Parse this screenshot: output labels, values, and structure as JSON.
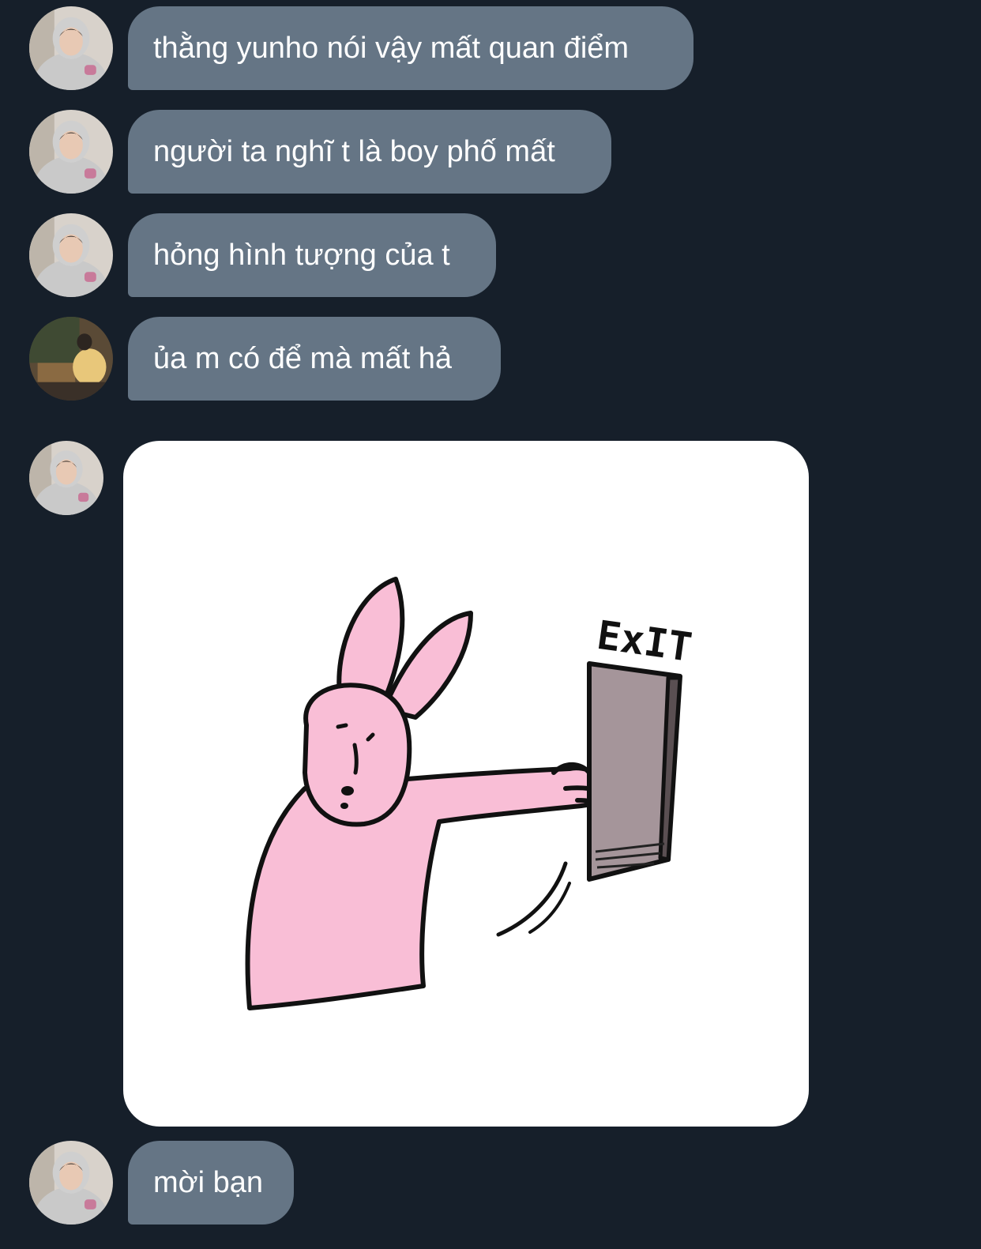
{
  "messages": [
    {
      "text": "thằng yunho nói vậy mất quan điểm",
      "avatar": "user-a"
    },
    {
      "text": "người ta nghĩ t là boy phố mất",
      "avatar": "user-a"
    },
    {
      "text": "hỏng hình tượng của t",
      "avatar": "user-a"
    },
    {
      "text": "ủa m có để mà mất hả",
      "avatar": "user-b"
    },
    {
      "sticker": "pink-rabbit-pushing-exit-door",
      "sticker_text": "ExIT",
      "avatar": "user-a"
    },
    {
      "text": "mời bạn",
      "avatar": "user-a"
    }
  ],
  "colors": {
    "background": "#161f2a",
    "bubble": "#657585",
    "bubble_text": "#ffffff",
    "rabbit_pink": "#f9bed6",
    "door": "#a5959a"
  }
}
